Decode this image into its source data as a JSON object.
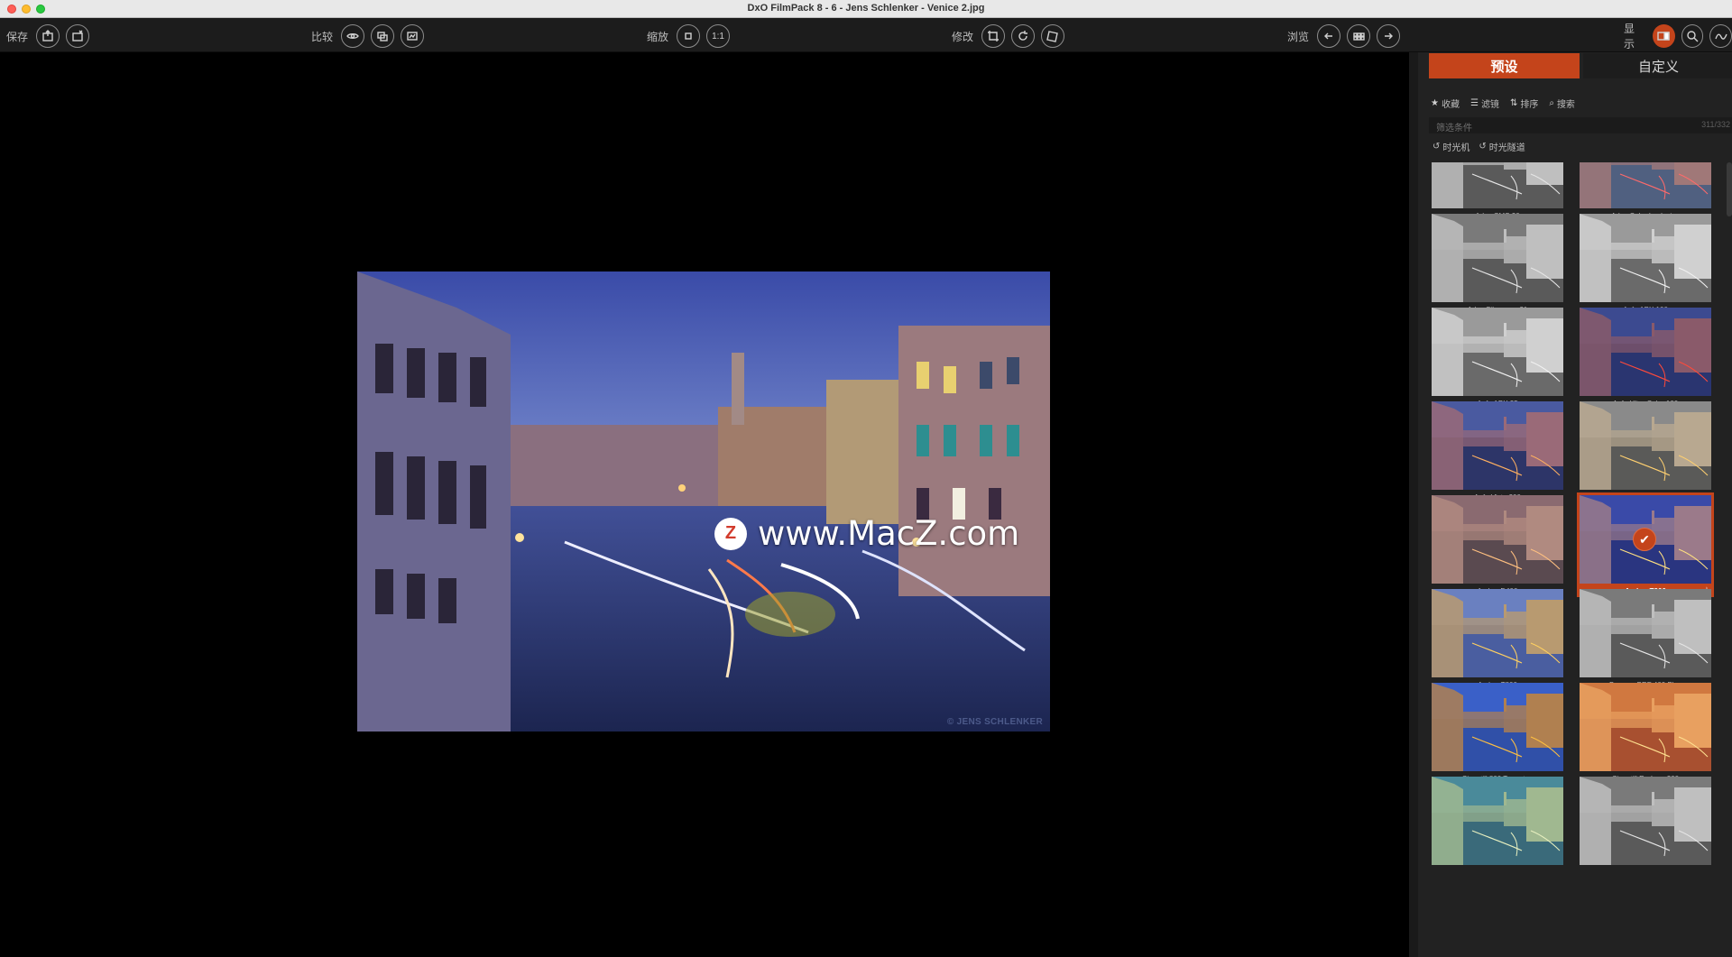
{
  "window": {
    "title": "DxO FilmPack 8 - 6 - Jens Schlenker - Venice 2.jpg"
  },
  "toolbar": {
    "save_label": "保存",
    "compare_label": "比较",
    "zoom_label": "缩放",
    "zoom_value": "1:1",
    "edit_label": "修改",
    "browse_label": "浏览",
    "display_label": "显示"
  },
  "image": {
    "watermark_text": "www.MacZ.com",
    "watermark_logo": "Z",
    "credit": "© JENS SCHLENKER"
  },
  "panel": {
    "tabs": [
      "预设",
      "自定义"
    ],
    "active_tab": 0,
    "filters": [
      "收藏",
      "滤镜",
      "排序",
      "搜索"
    ],
    "condition_placeholder": "筛选条件",
    "count": "311/332",
    "chips": [
      "时光机",
      "时光隧道"
    ],
    "presets": [
      {
        "name": "Adox CMS 20",
        "style": "bw"
      },
      {
        "name": "Adox Color Implosion",
        "style": "colorimp"
      },
      {
        "name": "Adox Silvermax 21",
        "style": "bw"
      },
      {
        "name": "Agfa APX 100",
        "style": "bwlight"
      },
      {
        "name": "Agfa APX 25",
        "style": "bwlight"
      },
      {
        "name": "Agfa Ultra Color 100",
        "style": "ultra"
      },
      {
        "name": "Agfa Vista 200",
        "style": "vista"
      },
      {
        "name": "Amber D100",
        "style": "amberd"
      },
      {
        "name": "Amber D400",
        "style": "amberd400"
      },
      {
        "name": "Amber T200",
        "style": "blue",
        "selected": true
      },
      {
        "name": "Amber T800",
        "style": "t800"
      },
      {
        "name": "Bergger BRF 400 Plus",
        "style": "bw"
      },
      {
        "name": "Cinestill 800 Tungsten",
        "style": "tungsten"
      },
      {
        "name": "Cinestill Redrum 200",
        "style": "redrum"
      },
      {
        "name": "",
        "style": "teal"
      },
      {
        "name": "",
        "style": "bw"
      }
    ]
  }
}
